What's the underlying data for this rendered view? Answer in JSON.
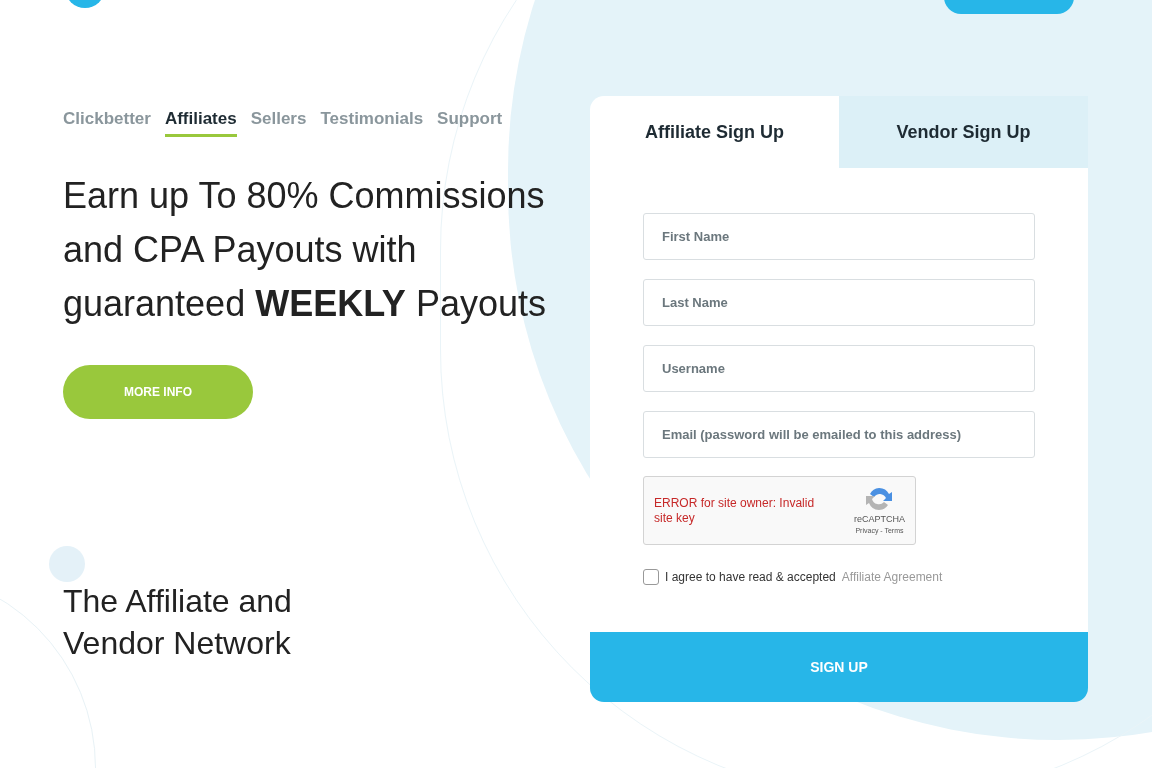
{
  "nav": [
    {
      "label": "Clickbetter",
      "selected": false
    },
    {
      "label": "Affiliates",
      "selected": true
    },
    {
      "label": "Sellers",
      "selected": false
    },
    {
      "label": "Testimonials",
      "selected": false
    },
    {
      "label": "Support",
      "selected": false
    }
  ],
  "headline": "Earn up To 80% Commissions and CPA Payouts with guaranteed **WEEKLY** Payouts",
  "more_info_button": "MORE INFO",
  "subheading": "The Affiliate and Vendor Network",
  "form": {
    "tabs": [
      {
        "label": "Affiliate Sign Up",
        "selected": true
      },
      {
        "label": "Vendor Sign Up",
        "selected": false
      }
    ],
    "fields": [
      {
        "placeholder": "First Name"
      },
      {
        "placeholder": "Last Name"
      },
      {
        "placeholder": "Username"
      },
      {
        "placeholder": "Email (password will be emailed to this address)"
      }
    ],
    "captcha": {
      "error": "ERROR for site owner: Invalid site key",
      "brand": "reCAPTCHA",
      "links": "Privacy - Terms"
    },
    "agreement": {
      "checked": false,
      "text": "I agree to have read & accepted",
      "link": "Affiliate Agreement"
    },
    "submit": "SIGN UP"
  }
}
